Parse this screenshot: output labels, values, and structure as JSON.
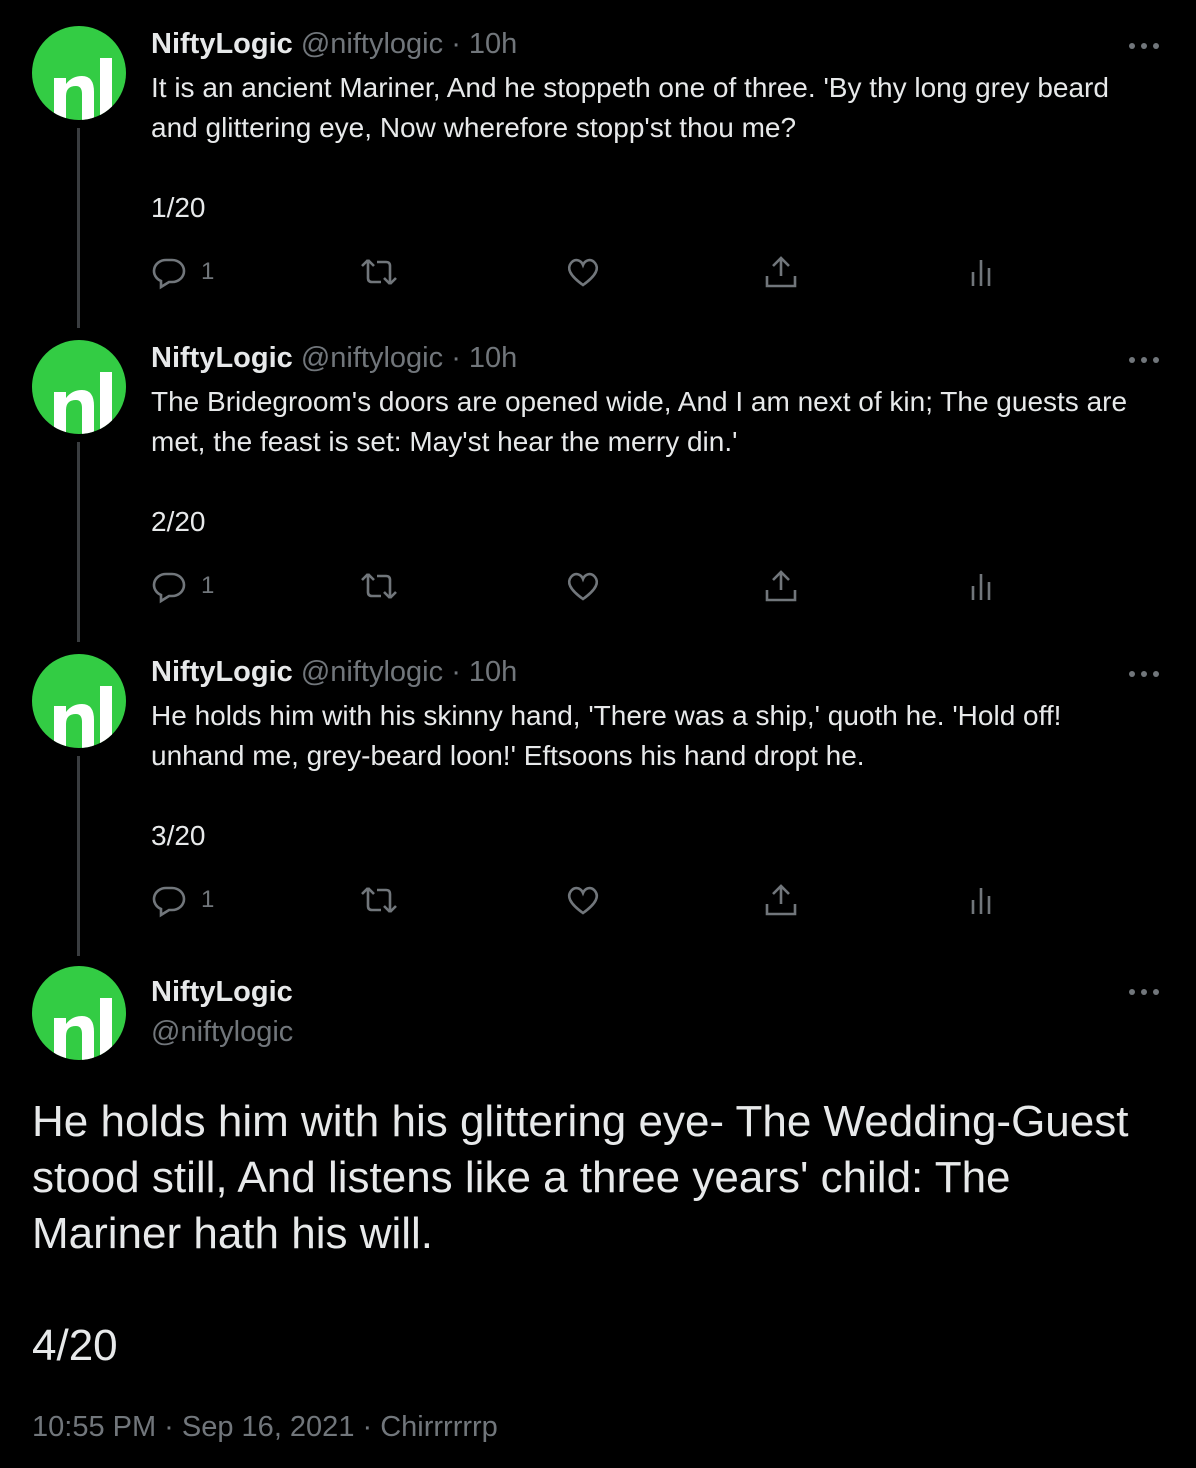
{
  "colors": {
    "background": "#000000",
    "text": "#e7e9ea",
    "secondary": "#71767b",
    "avatar": "#33cc44",
    "thread_line": "#3a3d40"
  },
  "tweets": [
    {
      "name": "NiftyLogic",
      "handle": "@niftylogic",
      "separator": "·",
      "time": "10h",
      "text": "It is an ancient Mariner, And he stoppeth one of three. 'By thy long grey beard and glittering eye, Now wherefore stopp'st thou me?",
      "count": "1/20",
      "replies": "1",
      "icons": {
        "more": "more-icon",
        "reply": "reply-icon",
        "retweet": "retweet-icon",
        "like": "like-icon",
        "share": "share-icon",
        "analytics": "analytics-icon"
      }
    },
    {
      "name": "NiftyLogic",
      "handle": "@niftylogic",
      "separator": "·",
      "time": "10h",
      "text": "The Bridegroom's doors are opened wide, And I am next of kin; The guests are met, the feast is set: May'st hear the merry din.'",
      "count": "2/20",
      "replies": "1"
    },
    {
      "name": "NiftyLogic",
      "handle": "@niftylogic",
      "separator": "·",
      "time": "10h",
      "text": "He holds him with his skinny hand, 'There was a ship,' quoth he. 'Hold off! unhand me, grey-beard loon!' Eftsoons his hand dropt he.",
      "count": "3/20",
      "replies": "1"
    }
  ],
  "main_tweet": {
    "name": "NiftyLogic",
    "handle": "@niftylogic",
    "text": "He holds him with his glittering eye- The Wedding-Guest stood still, And listens like a three years' child: The Mariner hath his will.",
    "count": "4/20",
    "meta": "10:55 PM · Sep 16, 2021 · Chirrrrrrp"
  }
}
